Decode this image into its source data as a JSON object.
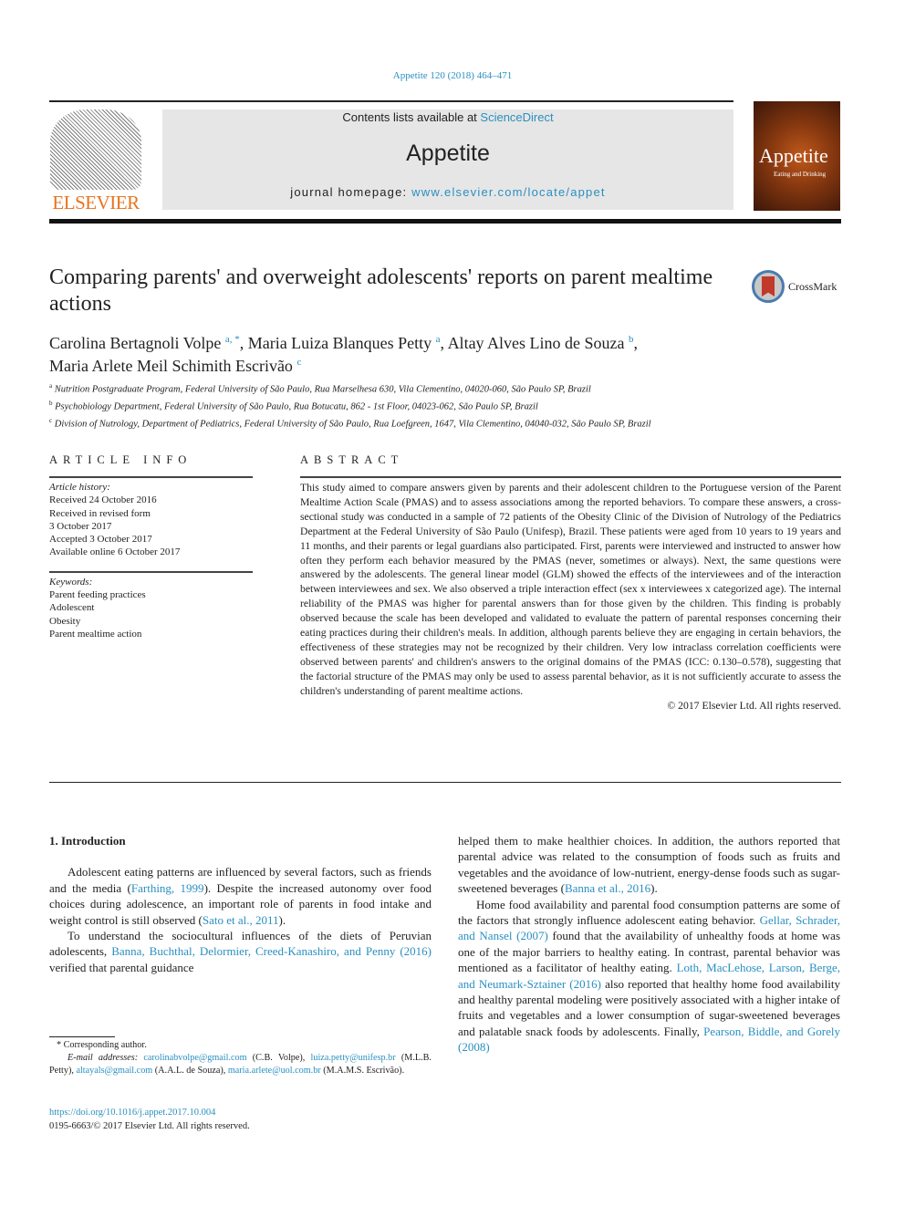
{
  "header": {
    "citation": "Appetite 120 (2018) 464–471",
    "contents_prefix": "Contents lists available at ",
    "contents_link": "ScienceDirect",
    "journal_name": "Appetite",
    "homepage_prefix": "journal homepage: ",
    "homepage_link": "www.elsevier.com/locate/appet",
    "publisher_logo_text": "ELSEVIER",
    "cover_title": "Appetite",
    "cover_subtitle": "Eating and Drinking"
  },
  "article": {
    "title": "Comparing parents' and overweight adolescents' reports on parent mealtime actions",
    "crossmark_label": "CrossMark",
    "authors": [
      {
        "name": "Carolina Bertagnoli Volpe",
        "sup": "a, *",
        "sep": ", "
      },
      {
        "name": "Maria Luiza Blanques Petty",
        "sup": "a",
        "sep": ", "
      },
      {
        "name": "Altay Alves Lino de Souza",
        "sup": "b",
        "sep": ","
      },
      {
        "name": "Maria Arlete Meil Schimith Escrivão",
        "sup": "c",
        "sep": ""
      }
    ],
    "affiliations": [
      {
        "sup": "a",
        "text": "Nutrition Postgraduate Program, Federal University of São Paulo, Rua Marselhesa 630, Vila Clementino, 04020-060, São Paulo SP, Brazil"
      },
      {
        "sup": "b",
        "text": "Psychobiology Department, Federal University of São Paulo, Rua Botucatu, 862 - 1st Floor, 04023-062, São Paulo SP, Brazil"
      },
      {
        "sup": "c",
        "text": "Division of Nutrology, Department of Pediatrics, Federal University of São Paulo, Rua Loefgreen, 1647, Vila Clementino, 04040-032, São Paulo SP, Brazil"
      }
    ]
  },
  "article_info": {
    "heading": "ARTICLE INFO",
    "history_label": "Article history:",
    "history": [
      "Received 24 October 2016",
      "Received in revised form",
      "3 October 2017",
      "Accepted 3 October 2017",
      "Available online 6 October 2017"
    ],
    "keywords_label": "Keywords:",
    "keywords": [
      "Parent feeding practices",
      "Adolescent",
      "Obesity",
      "Parent mealtime action"
    ]
  },
  "abstract": {
    "heading": "ABSTRACT",
    "text": "This study aimed to compare answers given by parents and their adolescent children to the Portuguese version of the Parent Mealtime Action Scale (PMAS) and to assess associations among the reported behaviors. To compare these answers, a cross-sectional study was conducted in a sample of 72 patients of the Obesity Clinic of the Division of Nutrology of the Pediatrics Department at the Federal University of São Paulo (Unifesp), Brazil. These patients were aged from 10 years to 19 years and 11 months, and their parents or legal guardians also participated. First, parents were interviewed and instructed to answer how often they perform each behavior measured by the PMAS (never, sometimes or always). Next, the same questions were answered by the adolescents. The general linear model (GLM) showed the effects of the interviewees and of the interaction between interviewees and sex. We also observed a triple interaction effect (sex x interviewees x categorized age). The internal reliability of the PMAS was higher for parental answers than for those given by the children. This finding is probably observed because the scale has been developed and validated to evaluate the pattern of parental responses concerning their eating practices during their children's meals. In addition, although parents believe they are engaging in certain behaviors, the effectiveness of these strategies may not be recognized by their children. Very low intraclass correlation coefficients were observed between parents' and children's answers to the original domains of the PMAS (ICC: 0.130–0.578), suggesting that the factorial structure of the PMAS may only be used to assess parental behavior, as it is not sufficiently accurate to assess the children's understanding of parent mealtime actions.",
    "copyright": "© 2017 Elsevier Ltd. All rights reserved."
  },
  "body": {
    "section_heading": "1.  Introduction",
    "left": {
      "p1_a": "Adolescent eating patterns are influenced by several factors, such as friends and the media (",
      "p1_link1": "Farthing, 1999",
      "p1_b": "). Despite the increased autonomy over food choices during adolescence, an important role of parents in food intake and weight control is still observed (",
      "p1_link2": "Sato et al., 2011",
      "p1_c": ").",
      "p2_a": "To understand the sociocultural influences of the diets of Peruvian adolescents, ",
      "p2_link": "Banna, Buchthal, Delormier, Creed-Kanashiro, and Penny (2016)",
      "p2_b": " verified that parental guidance"
    },
    "right": {
      "p1_a": "helped them to make healthier choices. In addition, the authors reported that parental advice was related to the consumption of foods such as fruits and vegetables and the avoidance of low-nutrient, energy-dense foods such as sugar-sweetened beverages (",
      "p1_link": "Banna et al., 2016",
      "p1_b": ").",
      "p2_a": "Home food availability and parental food consumption patterns are some of the factors that strongly influence adolescent eating behavior. ",
      "p2_link1": "Gellar, Schrader, and Nansel (2007)",
      "p2_b": " found that the availability of unhealthy foods at home was one of the major barriers to healthy eating. In contrast, parental behavior was mentioned as a facilitator of healthy eating. ",
      "p2_link2": "Loth, MacLehose, Larson, Berge, and Neumark-Sztainer (2016)",
      "p2_c": " also reported that healthy home food availability and healthy parental modeling were positively associated with a higher intake of fruits and vegetables and a lower consumption of sugar-sweetened beverages and palatable snack foods by adolescents. Finally, ",
      "p2_link3": "Pearson, Biddle, and Gorely (2008)"
    }
  },
  "footnotes": {
    "corresponding": "* Corresponding author.",
    "email_label": "E-mail addresses:",
    "emails": [
      {
        "addr": "carolinabvolpe@gmail.com",
        "who": " (C.B. Volpe), "
      },
      {
        "addr": "luiza.petty@unifesp.br",
        "who": " (M.L.B. Petty), "
      },
      {
        "addr": "altayals@gmail.com",
        "who": " (A.A.L. de Souza), "
      },
      {
        "addr": "maria.arlete@uol.com.br",
        "who": " (M.A.M.S. Escrivão)."
      }
    ],
    "doi": "https://doi.org/10.1016/j.appet.2017.10.004",
    "issn": "0195-6663/© 2017 Elsevier Ltd. All rights reserved."
  }
}
